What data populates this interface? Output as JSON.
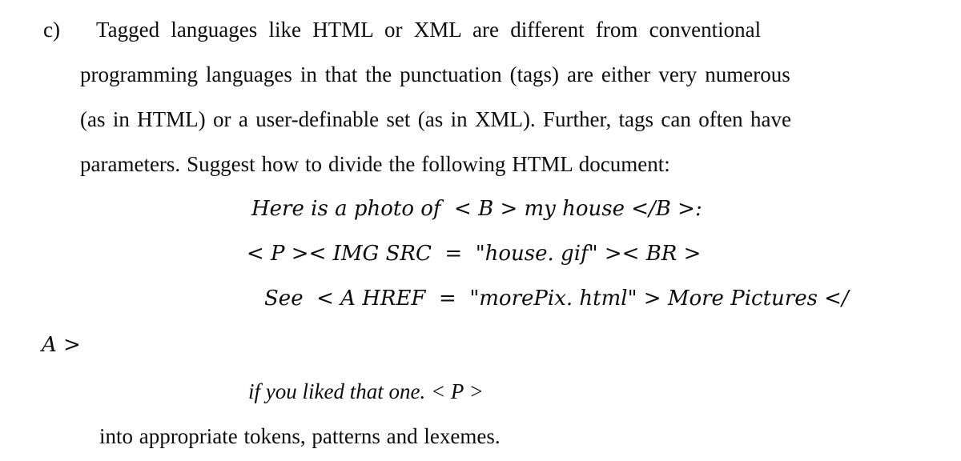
{
  "document": {
    "question": {
      "marker": "c)",
      "body_lines": [
        "Tagged languages like HTML or XML are different from conventional",
        "programming languages in that the punctuation (tags) are either very numerous",
        "(as in HTML) or a user-definable set (as in XML). Further, tags can often have",
        "parameters. Suggest how to divide the following HTML document:"
      ],
      "closing_line": "into appropriate tokens, patterns and lexemes."
    },
    "code_sample": {
      "lines": [
        "Here is a photo of  < B > my house </B >:",
        "< P >< IMG SRC  =  \"house. gif\" >< BR >",
        "See  < A HREF  =  \"morePix. html\" > More Pictures </",
        "A >",
        "if you liked that one. < P >"
      ]
    },
    "colors": {
      "page_background": "#ffffff",
      "text": "#0d0d0d"
    }
  }
}
